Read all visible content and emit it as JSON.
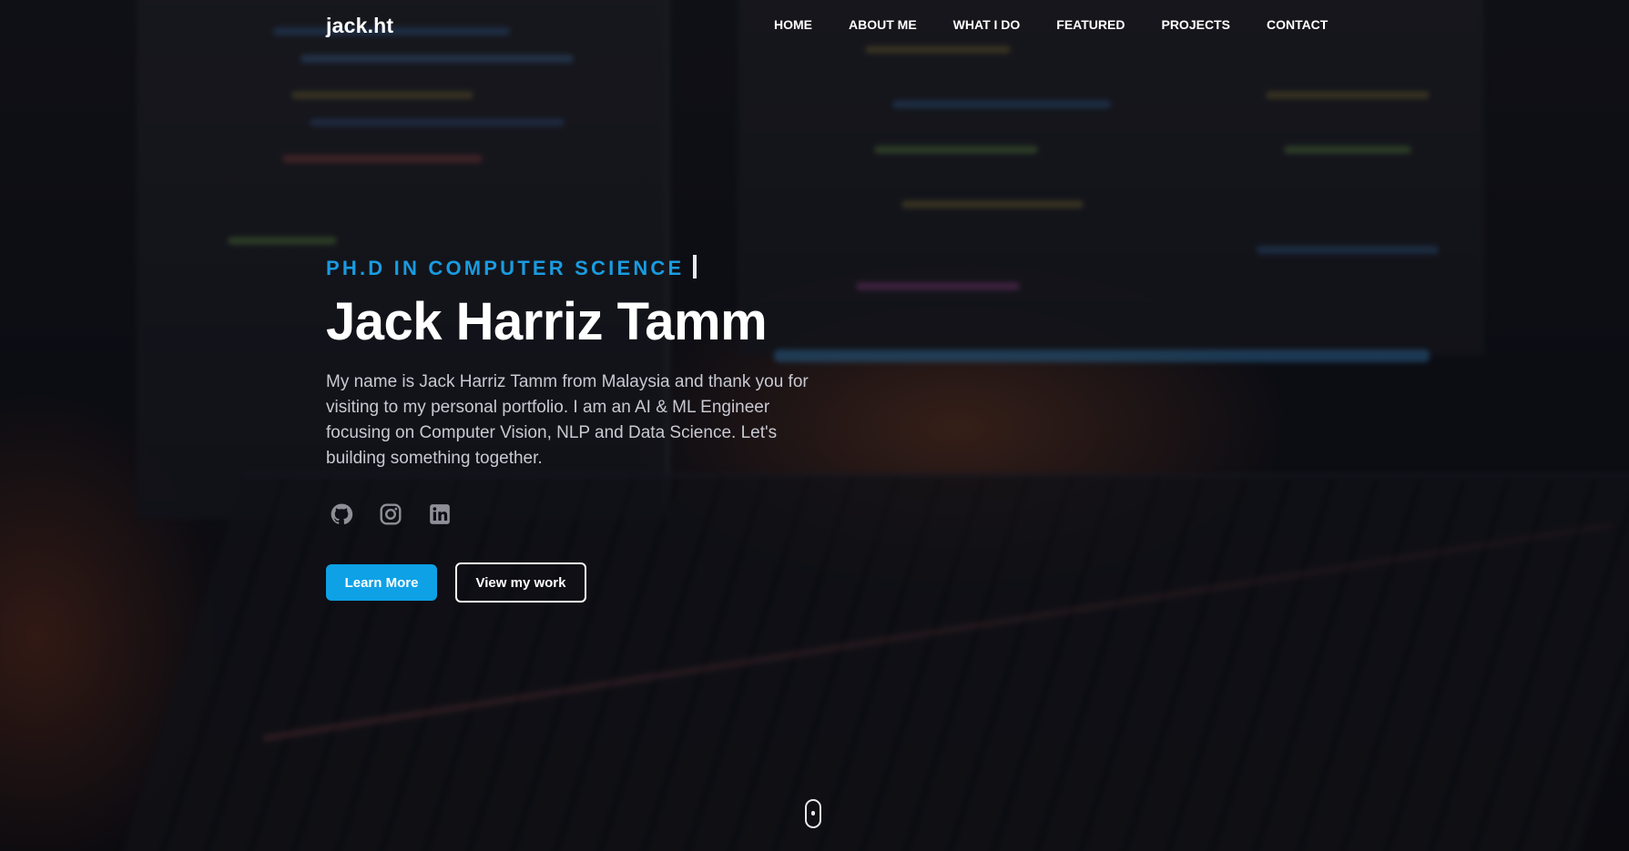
{
  "nav": {
    "logo": "jack.ht",
    "links": [
      "HOME",
      "ABOUT ME",
      "WHAT I DO",
      "FEATURED",
      "PROJECTS",
      "CONTACT"
    ]
  },
  "hero": {
    "subtitle": "PH.D IN COMPUTER SCIENCE",
    "name": "Jack Harriz Tamm",
    "description": "My name is Jack Harriz Tamm from Malaysia and thank you for visiting to my personal portfolio. I am an AI & ML Engineer focusing on Computer Vision, NLP and Data Science. Let's building something together.",
    "socials": [
      "github-icon",
      "instagram-icon",
      "linkedin-icon"
    ],
    "primary_button": "Learn More",
    "secondary_button": "View my work"
  },
  "colors": {
    "accent": "#0ea1e6",
    "subtitle": "#1a9be0",
    "text": "#ffffff",
    "body_text": "#c9c9d2",
    "background": "#0d0e14"
  }
}
